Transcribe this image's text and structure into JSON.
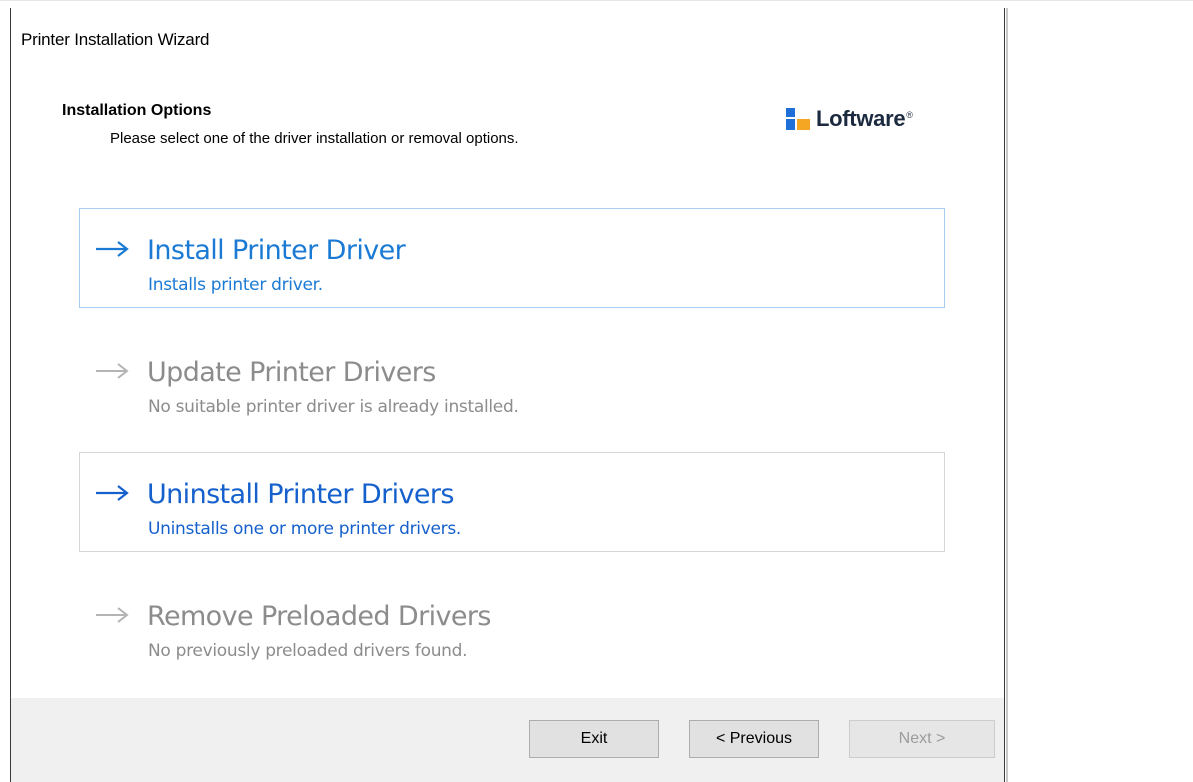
{
  "window": {
    "title": "Printer Installation Wizard"
  },
  "header": {
    "section_title": "Installation Options",
    "section_subtitle": "Please select one of the driver installation or removal options.",
    "logo_text": "Loftware",
    "logo_mark": "®"
  },
  "options": [
    {
      "title": "Install Printer Driver",
      "description": "Installs printer driver.",
      "enabled": true,
      "icon": "arrow-right-icon"
    },
    {
      "title": "Update Printer Drivers",
      "description": "No suitable printer driver is already installed.",
      "enabled": false,
      "icon": "arrow-right-icon"
    },
    {
      "title": "Uninstall Printer Drivers",
      "description": "Uninstalls one or more printer drivers.",
      "enabled": true,
      "icon": "arrow-right-icon"
    },
    {
      "title": "Remove Preloaded Drivers",
      "description": "No previously preloaded drivers found.",
      "enabled": false,
      "icon": "arrow-right-icon"
    }
  ],
  "footer": {
    "exit_label": "Exit",
    "previous_label": "< Previous",
    "next_label": "Next >"
  },
  "colors": {
    "link_blue": "#1a7ad4",
    "link_blue_dark": "#1560cc",
    "disabled_gray": "#8c8c8c",
    "highlight_border": "#a8cdf0",
    "logo_blue": "#1f6fd8",
    "logo_orange": "#f5a623",
    "footer_bg": "#f0f0f0"
  }
}
